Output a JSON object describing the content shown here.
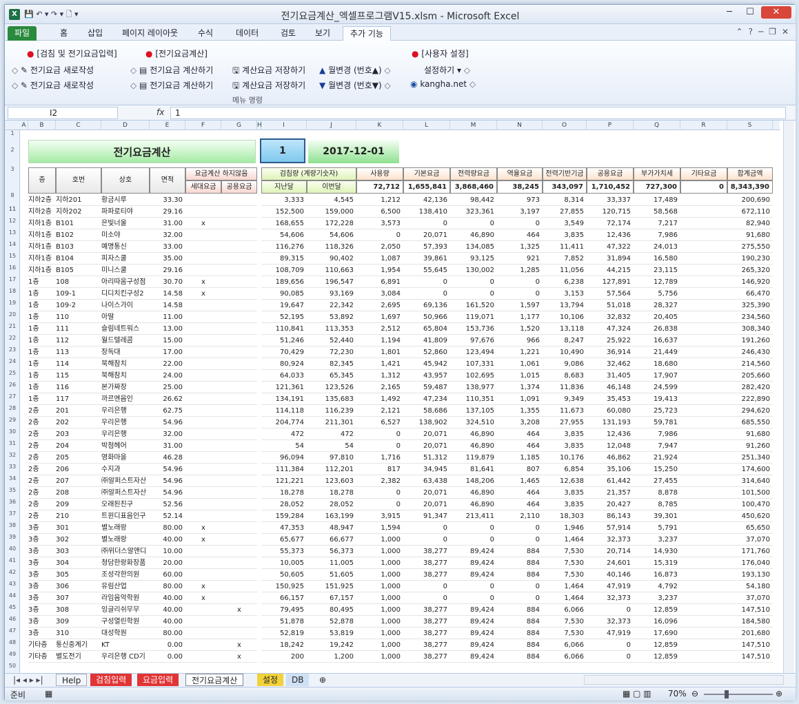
{
  "window": {
    "title": "전기요금계산_엑셀프로그램V15.xlsm - Microsoft Excel",
    "min": "─",
    "max": "☐",
    "close": "✕"
  },
  "ribbon_tabs": [
    "파일",
    "홈",
    "삽입",
    "페이지 레이아웃",
    "수식",
    "데이터",
    "검토",
    "보기",
    "추가 기능"
  ],
  "ribbon": {
    "row1": [
      "[검침 및 전기요금입력]",
      "[전기요금계산]",
      "[사용자 설정]"
    ],
    "row2": [
      "전기요금 새로작성",
      "전기요금 계산하기",
      "계산요금 저장하기",
      "월변경 (번호▲)",
      "설정하기 ▾"
    ],
    "row3": [
      "전기요금 새로작성",
      "전기요금 계산하기",
      "계산요금 저장하기",
      "월변경 (번호▼)",
      "kangha.net"
    ],
    "group_label": "메뉴 명령"
  },
  "formula": {
    "name_box": "I2",
    "fx": "fx",
    "value": "1"
  },
  "sheet": {
    "title": "전기요금계산",
    "month": "1",
    "date": "2017-12-01",
    "headers": {
      "floor": "층",
      "unit": "호번",
      "shop": "상호",
      "area": "면적",
      "nocalc": "요금계산 하지않음",
      "household": "세대요금",
      "common": "공용요금",
      "meter": "검침량 (계량기숫자)",
      "prev": "지난달",
      "curr": "이번달",
      "usage": "사용량",
      "base": "기본요금",
      "energy": "전력량요금",
      "climate": "역율요금",
      "fund": "전력기반기금",
      "commonfee": "공용요금",
      "vat": "부가가치세",
      "other": "기타요금",
      "total": "합계금액"
    },
    "totals": [
      "72,712",
      "1,655,841",
      "3,868,460",
      "38,245",
      "343,097",
      "1,710,452",
      "727,300",
      "0",
      "8,343,390"
    ],
    "rows": [
      [
        "지하2층",
        "지하201",
        "황금시루",
        "33.30",
        "",
        "",
        "3,333",
        "4,545",
        "1,212",
        "42,136",
        "98,442",
        "973",
        "8,314",
        "33,337",
        "17,489",
        "",
        "200,690"
      ],
      [
        "지하2층",
        "지하202",
        "파파로티야",
        "29.16",
        "",
        "",
        "152,500",
        "159,000",
        "6,500",
        "138,410",
        "323,361",
        "3,197",
        "27,855",
        "120,715",
        "58,568",
        "",
        "672,110"
      ],
      [
        "지하1층",
        "B101",
        "은빛너울",
        "31.00",
        "x",
        "",
        "168,655",
        "172,228",
        "3,573",
        "0",
        "0",
        "0",
        "3,549",
        "72,174",
        "7,217",
        "",
        "82,940"
      ],
      [
        "지하1층",
        "B102",
        "미소야",
        "32.00",
        "",
        "",
        "54,606",
        "54,606",
        "0",
        "20,071",
        "46,890",
        "464",
        "3,835",
        "12,436",
        "7,986",
        "",
        "91,680"
      ],
      [
        "지하1층",
        "B103",
        "예명통신",
        "33.00",
        "",
        "",
        "116,276",
        "118,326",
        "2,050",
        "57,393",
        "134,085",
        "1,325",
        "11,411",
        "47,322",
        "24,013",
        "",
        "275,550"
      ],
      [
        "지하1층",
        "B104",
        "피자스쿨",
        "35.00",
        "",
        "",
        "89,315",
        "90,402",
        "1,087",
        "39,861",
        "93,125",
        "921",
        "7,852",
        "31,894",
        "16,580",
        "",
        "190,230"
      ],
      [
        "지하1층",
        "B105",
        "미니스쿨",
        "29.16",
        "",
        "",
        "108,709",
        "110,663",
        "1,954",
        "55,645",
        "130,002",
        "1,285",
        "11,056",
        "44,215",
        "23,115",
        "",
        "265,320"
      ],
      [
        "1층",
        "108",
        "아리따움구성점",
        "30.70",
        "x",
        "",
        "189,656",
        "196,547",
        "6,891",
        "0",
        "0",
        "0",
        "6,238",
        "127,891",
        "12,789",
        "",
        "146,920"
      ],
      [
        "1층",
        "109-1",
        "디디치킨구성2",
        "14.58",
        "x",
        "",
        "90,085",
        "93,169",
        "3,084",
        "0",
        "0",
        "0",
        "3,153",
        "57,564",
        "5,756",
        "",
        "66,470"
      ],
      [
        "1층",
        "109-2",
        "나이스가이",
        "14.58",
        "",
        "",
        "19,647",
        "22,342",
        "2,695",
        "69,136",
        "161,520",
        "1,597",
        "13,794",
        "51,018",
        "28,327",
        "",
        "325,390"
      ],
      [
        "1층",
        "110",
        "아딸",
        "11.00",
        "",
        "",
        "52,195",
        "53,892",
        "1,697",
        "50,966",
        "119,071",
        "1,177",
        "10,106",
        "32,832",
        "20,405",
        "",
        "234,560"
      ],
      [
        "1층",
        "111",
        "슬림네트워스",
        "13.00",
        "",
        "",
        "110,841",
        "113,353",
        "2,512",
        "65,804",
        "153,736",
        "1,520",
        "13,118",
        "47,324",
        "26,838",
        "",
        "308,340"
      ],
      [
        "1층",
        "112",
        "월드텔레콤",
        "15.00",
        "",
        "",
        "51,246",
        "52,440",
        "1,194",
        "41,809",
        "97,676",
        "966",
        "8,247",
        "25,922",
        "16,637",
        "",
        "191,260"
      ],
      [
        "1층",
        "113",
        "장독대",
        "17.00",
        "",
        "",
        "70,429",
        "72,230",
        "1,801",
        "52,860",
        "123,494",
        "1,221",
        "10,490",
        "36,914",
        "21,449",
        "",
        "246,430"
      ],
      [
        "1층",
        "114",
        "북해참치",
        "22.00",
        "",
        "",
        "80,924",
        "82,345",
        "1,421",
        "45,942",
        "107,331",
        "1,061",
        "9,086",
        "32,462",
        "18,680",
        "",
        "214,560"
      ],
      [
        "1층",
        "115",
        "북해참치",
        "24.00",
        "",
        "",
        "64,033",
        "65,345",
        "1,312",
        "43,957",
        "102,695",
        "1,015",
        "8,683",
        "31,405",
        "17,907",
        "",
        "205,660"
      ],
      [
        "1층",
        "116",
        "본가짜장",
        "25.00",
        "",
        "",
        "121,361",
        "123,526",
        "2,165",
        "59,487",
        "138,977",
        "1,374",
        "11,836",
        "46,148",
        "24,599",
        "",
        "282,420"
      ],
      [
        "1층",
        "117",
        "까르멘음인",
        "26.62",
        "",
        "",
        "134,191",
        "135,683",
        "1,492",
        "47,234",
        "110,351",
        "1,091",
        "9,349",
        "35,453",
        "19,413",
        "",
        "222,890"
      ],
      [
        "2층",
        "201",
        "우리은행",
        "62.75",
        "",
        "",
        "114,118",
        "116,239",
        "2,121",
        "58,686",
        "137,105",
        "1,355",
        "11,673",
        "60,080",
        "25,723",
        "",
        "294,620"
      ],
      [
        "2층",
        "202",
        "우리은행",
        "54.96",
        "",
        "",
        "204,774",
        "211,301",
        "6,527",
        "138,902",
        "324,510",
        "3,208",
        "27,955",
        "131,193",
        "59,781",
        "",
        "685,550"
      ],
      [
        "2층",
        "203",
        "우리은행",
        "32.00",
        "",
        "",
        "472",
        "472",
        "0",
        "20,071",
        "46,890",
        "464",
        "3,835",
        "12,436",
        "7,986",
        "",
        "91,680"
      ],
      [
        "2층",
        "204",
        "박첨헤어",
        "31.00",
        "",
        "",
        "54",
        "54",
        "0",
        "20,071",
        "46,890",
        "464",
        "3,835",
        "12,048",
        "7,947",
        "",
        "91,260"
      ],
      [
        "2층",
        "205",
        "영화마을",
        "46.28",
        "",
        "",
        "96,094",
        "97,810",
        "1,716",
        "51,312",
        "119,879",
        "1,185",
        "10,176",
        "46,862",
        "21,924",
        "",
        "251,340"
      ],
      [
        "2층",
        "206",
        "수지과",
        "54.96",
        "",
        "",
        "111,384",
        "112,201",
        "817",
        "34,945",
        "81,641",
        "807",
        "6,854",
        "35,106",
        "15,250",
        "",
        "174,600"
      ],
      [
        "2층",
        "207",
        "㈜알퍼스트자산",
        "54.96",
        "",
        "",
        "121,221",
        "123,603",
        "2,382",
        "63,438",
        "148,206",
        "1,465",
        "12,638",
        "61,442",
        "27,455",
        "",
        "314,640"
      ],
      [
        "2층",
        "208",
        "㈜알퍼스트자산",
        "54.96",
        "",
        "",
        "18,278",
        "18,278",
        "0",
        "20,071",
        "46,890",
        "464",
        "3,835",
        "21,357",
        "8,878",
        "",
        "101,500"
      ],
      [
        "2층",
        "209",
        "오래된친구",
        "52.56",
        "",
        "",
        "28,052",
        "28,052",
        "0",
        "20,071",
        "46,890",
        "464",
        "3,835",
        "20,427",
        "8,785",
        "",
        "100,470"
      ],
      [
        "2층",
        "210",
        "트윈디표음인구",
        "52.14",
        "",
        "",
        "159,284",
        "163,199",
        "3,915",
        "91,347",
        "213,411",
        "2,110",
        "18,303",
        "86,143",
        "39,301",
        "",
        "450,620"
      ],
      [
        "3층",
        "301",
        "별노래랑",
        "80.00",
        "x",
        "",
        "47,353",
        "48,947",
        "1,594",
        "0",
        "0",
        "0",
        "1,946",
        "57,914",
        "5,791",
        "",
        "65,650"
      ],
      [
        "3층",
        "302",
        "별노래랑",
        "40.00",
        "x",
        "",
        "65,677",
        "66,677",
        "1,000",
        "0",
        "0",
        "0",
        "1,464",
        "32,373",
        "3,237",
        "",
        "37,070"
      ],
      [
        "3층",
        "303",
        "㈜위더스알앤디",
        "10.00",
        "",
        "",
        "55,373",
        "56,373",
        "1,000",
        "38,277",
        "89,424",
        "884",
        "7,530",
        "20,714",
        "14,930",
        "",
        "171,760"
      ],
      [
        "3층",
        "304",
        "청담한랑화장품",
        "20.00",
        "",
        "",
        "10,005",
        "11,005",
        "1,000",
        "38,277",
        "89,424",
        "884",
        "7,530",
        "24,601",
        "15,319",
        "",
        "176,040"
      ],
      [
        "3층",
        "305",
        "조성각한의원",
        "60.00",
        "",
        "",
        "50,605",
        "51,605",
        "1,000",
        "38,277",
        "89,424",
        "884",
        "7,530",
        "40,146",
        "16,873",
        "",
        "193,130"
      ],
      [
        "3층",
        "306",
        "유림산업",
        "80.00",
        "x",
        "",
        "150,925",
        "151,925",
        "1,000",
        "0",
        "0",
        "0",
        "1,464",
        "47,919",
        "4,792",
        "",
        "54,180"
      ],
      [
        "3층",
        "307",
        "라임음악학원",
        "40.00",
        "x",
        "",
        "66,157",
        "67,157",
        "1,000",
        "0",
        "0",
        "0",
        "1,464",
        "32,373",
        "3,237",
        "",
        "37,070"
      ],
      [
        "3층",
        "308",
        "잉글리쉬무무",
        "40.00",
        "",
        "x",
        "79,495",
        "80,495",
        "1,000",
        "38,277",
        "89,424",
        "884",
        "6,066",
        "0",
        "12,859",
        "",
        "147,510"
      ],
      [
        "3층",
        "309",
        "구성열린학원",
        "40.00",
        "",
        "",
        "51,878",
        "52,878",
        "1,000",
        "38,277",
        "89,424",
        "884",
        "7,530",
        "32,373",
        "16,096",
        "",
        "184,580"
      ],
      [
        "3층",
        "310",
        "대성학원",
        "80.00",
        "",
        "",
        "52,819",
        "53,819",
        "1,000",
        "38,277",
        "89,424",
        "884",
        "7,530",
        "47,919",
        "17,690",
        "",
        "201,680"
      ],
      [
        "기타층",
        "통신중계기",
        "KT",
        "0.00",
        "",
        "x",
        "18,242",
        "19,242",
        "1,000",
        "38,277",
        "89,424",
        "884",
        "6,066",
        "0",
        "12,859",
        "",
        "147,510"
      ],
      [
        "기타층",
        "별도전기",
        "우리은행 CD기",
        "0.00",
        "",
        "x",
        "200",
        "1,200",
        "1,000",
        "38,277",
        "89,424",
        "884",
        "6,066",
        "0",
        "12,859",
        "",
        "147,510"
      ]
    ]
  },
  "sheet_tabs": [
    "Help",
    "검침입력",
    "요금입력",
    "전기요금계산",
    "설정",
    "DB"
  ],
  "status": {
    "ready": "준비",
    "zoom": "70%"
  }
}
